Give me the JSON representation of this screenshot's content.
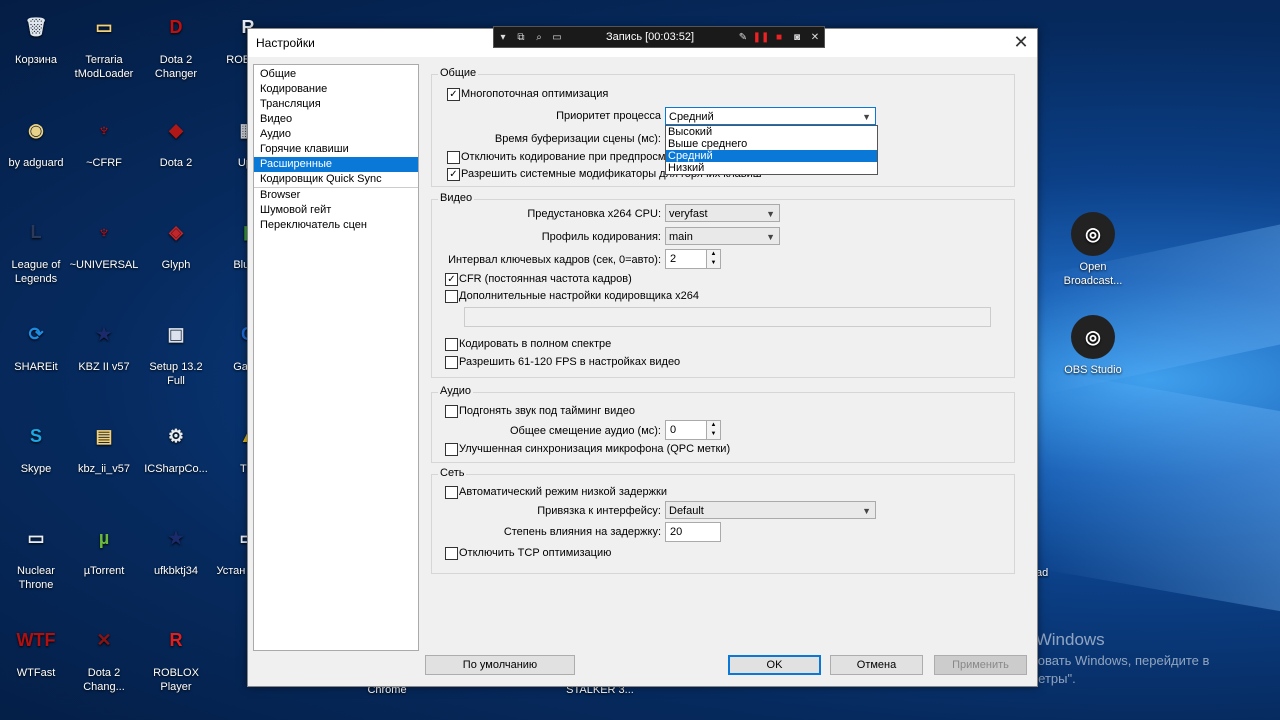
{
  "desktop": {
    "icons": [
      {
        "label": "Корзина",
        "color": "#dfe6ee",
        "glyph": "🗑"
      },
      {
        "label": "Terraria tModLoader",
        "color": "#f2d17a",
        "glyph": "▭"
      },
      {
        "label": "Dota 2 Changer",
        "color": "#c01010",
        "glyph": "D"
      },
      {
        "label": "ROB Stu",
        "color": "#e8eef8",
        "glyph": "R"
      },
      {
        "label": "by adguard",
        "color": "#e8d28a",
        "glyph": "◉"
      },
      {
        "label": "~CFRF",
        "color": "#cc1010",
        "glyph": "♆"
      },
      {
        "label": "Dota 2",
        "color": "#b01818",
        "glyph": "◆"
      },
      {
        "label": "Upd",
        "color": "#c8ccd4",
        "glyph": "▦"
      },
      {
        "label": "League of Legends",
        "color": "#2b3a5a",
        "glyph": "L"
      },
      {
        "label": "~UNIVERSAL",
        "color": "#cc1010",
        "glyph": "♆"
      },
      {
        "label": "Glyph",
        "color": "#c0262a",
        "glyph": "◈"
      },
      {
        "label": "BlueS",
        "color": "#3a9c3a",
        "glyph": "▮"
      },
      {
        "label": "SHAREit",
        "color": "#1f8be0",
        "glyph": "⟳"
      },
      {
        "label": "KBZ II v57",
        "color": "#1a2a6a",
        "glyph": "★"
      },
      {
        "label": "Setup 13.2 Full",
        "color": "#dce3ee",
        "glyph": "▣"
      },
      {
        "label": "Garry'",
        "color": "#1a6ad8",
        "glyph": "G"
      },
      {
        "label": "Skype",
        "color": "#1ca8e4",
        "glyph": "S"
      },
      {
        "label": "kbz_ii_v57",
        "color": "#f2d17a",
        "glyph": "▤"
      },
      {
        "label": "ICSharpCo...",
        "color": "#e9ecef",
        "glyph": "⚙"
      },
      {
        "label": "Tro",
        "color": "#e2b814",
        "glyph": "▲"
      },
      {
        "label": "Nuclear Throne",
        "color": "#e8eef8",
        "glyph": "▭"
      },
      {
        "label": "µTorrent",
        "color": "#6bb83a",
        "glyph": "µ"
      },
      {
        "label": "ufkbktj34",
        "color": "#1a2a6a",
        "glyph": "★"
      },
      {
        "label": "Устан Kaspe",
        "color": "#e8eef8",
        "glyph": "▭"
      },
      {
        "label": "WTFast",
        "color": "#b01010",
        "glyph": "WTF"
      },
      {
        "label": "Dota 2 Chang...",
        "color": "#8a1414",
        "glyph": "✕"
      },
      {
        "label": "ROBLOX Player",
        "color": "#e02020",
        "glyph": "R"
      }
    ],
    "right_icons": [
      {
        "label": "Open Broadcast...",
        "glyph": "◎"
      },
      {
        "label": "OBS Studio",
        "glyph": "◎"
      }
    ],
    "partial_right_label": "ad",
    "bottom_labels": {
      "chrome": "Chrome",
      "stalker": "STALKER 3..."
    },
    "activation_title": "Активация Windows",
    "activation_text": "Чтобы активировать Windows, перейдите в раздел \"Параметры\"."
  },
  "recorder": {
    "title": "Запись [00:03:52]"
  },
  "dialog": {
    "title": "Настройки",
    "nav": [
      "Общие",
      "Кодирование",
      "Трансляция",
      "Видео",
      "Аудио",
      "Горячие клавиши",
      "Расширенные",
      "Кодировщик Quick Sync",
      "Browser",
      "Шумовой гейт",
      "Переключатель сцен"
    ],
    "nav_selected_index": 6,
    "general": {
      "group_label": "Общие",
      "multithread_label": "Многопоточная оптимизация",
      "priority_label": "Приоритет процесса",
      "priority_value": "Средний",
      "priority_options": [
        "Высокий",
        "Выше среднего",
        "Средний",
        "Низкий"
      ],
      "priority_selected": "Средний",
      "buffer_label": "Время буферизации сцены (мс):",
      "disable_encoding_label": "Отключить кодирование при предпросмотре",
      "allow_modifiers_label": "Разрешить системные модификаторы для горячих клавиш"
    },
    "video": {
      "group_label": "Видео",
      "preset_label": "Предустановка x264 CPU:",
      "preset_value": "veryfast",
      "profile_label": "Профиль кодирования:",
      "profile_value": "main",
      "keyframe_label": "Интервал ключевых кадров (сек, 0=авто):",
      "keyframe_value": "2",
      "cfr_label": "CFR (постоянная частота кадров)",
      "extra_settings_label": "Дополнительные настройки кодировщика x264",
      "full_range_label": "Кодировать в полном спектре",
      "fps_label": "Разрешить 61-120 FPS в настройках видео"
    },
    "audio": {
      "group_label": "Аудио",
      "sync_label": "Подгонять звук под тайминг видео",
      "offset_label": "Общее смещение аудио (мс):",
      "offset_value": "0",
      "mic_label": "Улучшенная синхронизация микрофона (QPC метки)"
    },
    "network": {
      "group_label": "Сеть",
      "low_latency_label": "Автоматический режим низкой задержки",
      "bind_label": "Привязка к интерфейсу:",
      "bind_value": "Default",
      "latency_factor_label": "Степень влияния на задержку:",
      "latency_factor_value": "20",
      "tcp_label": "Отключить TCP оптимизацию"
    },
    "buttons": {
      "defaults": "По умолчанию",
      "ok": "OK",
      "cancel": "Отмена",
      "apply": "Применить"
    }
  }
}
